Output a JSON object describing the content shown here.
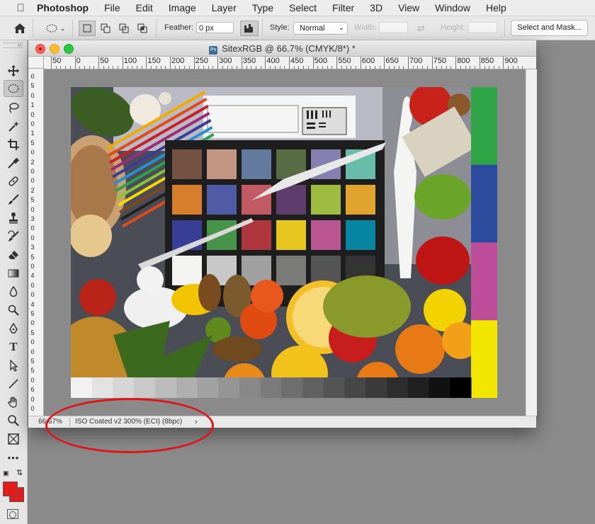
{
  "menubar": {
    "apple_icon": "apple-logo-icon",
    "app_name": "Photoshop",
    "items": [
      "File",
      "Edit",
      "Image",
      "Layer",
      "Type",
      "Select",
      "Filter",
      "3D",
      "View",
      "Window",
      "Help"
    ]
  },
  "options_bar": {
    "home_icon": "home-icon",
    "tool_preset_icon": "ellipse-marquee-icon",
    "selection_modes": [
      "new-selection",
      "add-to-selection",
      "subtract-from-selection",
      "intersect-with-selection"
    ],
    "feather_label": "Feather:",
    "feather_value": "0 px",
    "anti_alias_icon": "anti-alias-icon",
    "style_label": "Style:",
    "style_value": "Normal",
    "width_label": "Width:",
    "width_value": "",
    "swap_icon": "swap-arrows-icon",
    "height_label": "Height:",
    "height_value": "",
    "select_mask_label": "Select and Mask..."
  },
  "toolbar": {
    "collapse_label": "‹‹",
    "tools": [
      "move-tool",
      "elliptical-marquee-tool",
      "lasso-tool",
      "magic-wand-tool",
      "crop-tool",
      "eyedropper-tool",
      "healing-brush-tool",
      "brush-tool",
      "clone-stamp-tool",
      "history-brush-tool",
      "eraser-tool",
      "gradient-tool",
      "blur-tool",
      "dodge-tool",
      "pen-tool",
      "type-tool",
      "path-selection-tool",
      "line-tool",
      "hand-tool",
      "zoom-tool",
      "frame-tool",
      "more-tools"
    ],
    "foreground_color": "#e31b1b",
    "background_color": "#e31b1b"
  },
  "document": {
    "title": "SitexRGB @ 66.7% (CMYK/8*) *",
    "ps_icon_text": "Ps",
    "ruler_h": [
      "50",
      "0",
      "50",
      "100",
      "150",
      "200",
      "250",
      "300",
      "350",
      "400",
      "450",
      "500",
      "550",
      "600",
      "650",
      "700",
      "750",
      "800",
      "850",
      "900"
    ],
    "ruler_v": [
      "0",
      "5",
      "0",
      "1",
      "0",
      "0",
      "1",
      "5",
      "0",
      "2",
      "0",
      "0",
      "2",
      "5",
      "0",
      "3",
      "0",
      "0",
      "3",
      "5",
      "0",
      "4",
      "0",
      "0",
      "4",
      "5",
      "0",
      "5",
      "0",
      "0",
      "5",
      "5",
      "0",
      "6",
      "0",
      "0"
    ],
    "zoom": "66.67%",
    "color_profile": "ISO Coated v2 300% (ECI) (8bpc)",
    "status_arrow": "›"
  },
  "photo": {
    "checker_colors": [
      "#735244",
      "#c29682",
      "#627a9d",
      "#576c43",
      "#8580b1",
      "#67bdaa",
      "#d67e2c",
      "#505ba6",
      "#c15a63",
      "#5e3c6c",
      "#9dbc40",
      "#e0a32e",
      "#383d96",
      "#469449",
      "#af363c",
      "#e7c71f",
      "#bb5695",
      "#0885a1",
      "#f3f3f2",
      "#c8c8c8",
      "#a0a0a0",
      "#7a7a79",
      "#555555",
      "#343434"
    ],
    "side_bars": [
      "#2fa548",
      "#2c4a9e",
      "#bf4e9a",
      "#f2e600"
    ],
    "grey_steps": [
      "#f1f1f1",
      "#e3e3e3",
      "#d6d6d6",
      "#c9c9c9",
      "#bcbcbc",
      "#afafaf",
      "#a2a2a2",
      "#959595",
      "#888888",
      "#7b7b7b",
      "#6e6e6e",
      "#616161",
      "#545454",
      "#474747",
      "#3a3a3a",
      "#2d2d2d",
      "#202020",
      "#111111",
      "#000000"
    ]
  }
}
